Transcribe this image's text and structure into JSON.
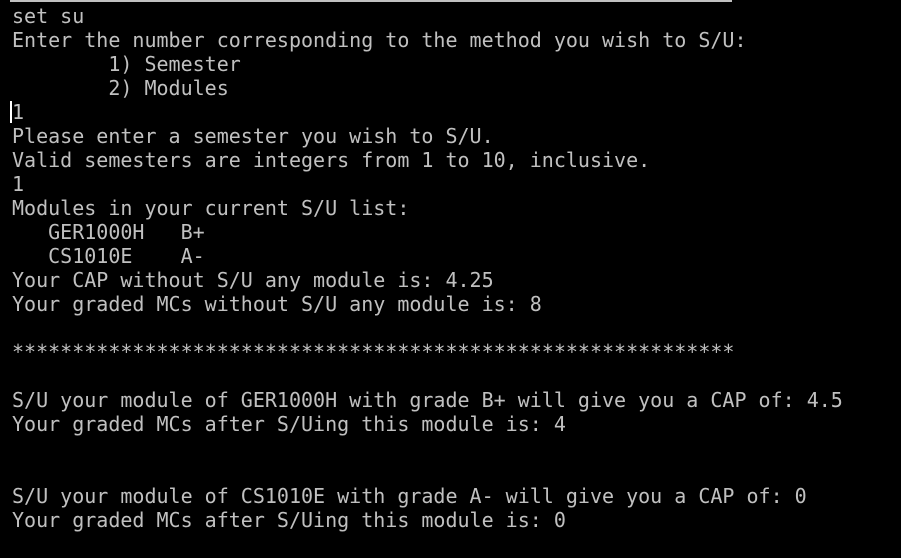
{
  "terminal": {
    "lines": [
      "set su",
      "Enter the number corresponding to the method you wish to S/U:",
      "        1) Semester",
      "        2) Modules",
      "1",
      "Please enter a semester you wish to S/U.",
      "Valid semesters are integers from 1 to 10, inclusive.",
      "1",
      "Modules in your current S/U list:",
      "   GER1000H   B+",
      "   CS1010E    A-",
      "Your CAP without S/U any module is: 4.25",
      "Your graded MCs without S/U any module is: 8",
      "",
      "************************************************************",
      "",
      "S/U your module of GER1000H with grade B+ will give you a CAP of: 4.5",
      "Your graded MCs after S/Uing this module is: 4",
      "",
      "",
      "S/U your module of CS1010E with grade A- will give you a CAP of: 0",
      "Your graded MCs after S/Uing this module is: 0"
    ]
  }
}
